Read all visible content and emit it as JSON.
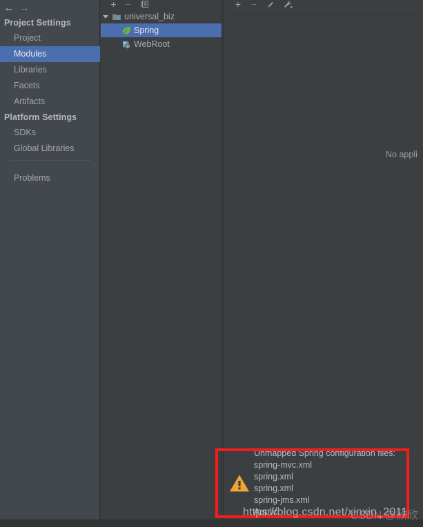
{
  "window": {
    "background_color": "#3c3f41",
    "accent_color": "#4b6eaf",
    "warning_color": "#f0a732",
    "callout_color": "#f41d1d"
  },
  "sidebar": {
    "nav": {
      "back_icon": "arrow-left-icon",
      "back_glyph": "←",
      "forward_icon": "arrow-right-icon",
      "forward_glyph": "→"
    },
    "sections": [
      {
        "header": "Project Settings",
        "items": [
          {
            "label": "Project",
            "selected": false
          },
          {
            "label": "Modules",
            "selected": true
          },
          {
            "label": "Libraries",
            "selected": false
          },
          {
            "label": "Facets",
            "selected": false
          },
          {
            "label": "Artifacts",
            "selected": false
          }
        ]
      },
      {
        "header": "Platform Settings",
        "items": [
          {
            "label": "SDKs",
            "selected": false
          },
          {
            "label": "Global Libraries",
            "selected": false
          }
        ]
      }
    ],
    "extra_items": [
      {
        "label": "Problems",
        "selected": false
      }
    ]
  },
  "tree_panel": {
    "toolbar": {
      "add_label": "+",
      "add_icon": "plus-icon",
      "remove_label": "−",
      "remove_icon": "minus-icon",
      "copy_label": "▤",
      "copy_icon": "copy-module-icon"
    },
    "rows": [
      {
        "label": "universal_biz",
        "icon": "module-folder-icon",
        "depth": 0,
        "expanded": true,
        "selected": false
      },
      {
        "label": "Spring",
        "icon": "spring-leaf-icon",
        "depth": 1,
        "expanded": null,
        "selected": true
      },
      {
        "label": "WebRoot",
        "icon": "web-facet-icon",
        "depth": 1,
        "expanded": null,
        "selected": false
      }
    ]
  },
  "right_panel": {
    "toolbar": {
      "add_label": "+",
      "add_icon": "plus-icon",
      "remove_label": "−",
      "remove_icon": "minus-icon",
      "edit_label": "╱",
      "edit_icon": "pencil-edit-icon",
      "facets_label": "⚒",
      "facets_icon": "wrench-dropdown-icon"
    },
    "empty_message": "No appli"
  },
  "warning": {
    "icon": "warning-triangle-icon",
    "lines": [
      "Unmapped Spring configuration files:",
      "spring-mvc.xml",
      "spring.xml",
      "spring.xml",
      "spring-jms.xml",
      "Applic"
    ]
  },
  "watermark": {
    "url": "https://blog.csdn.net/xinxin_2011",
    "mark": "CSDN @欣欣"
  }
}
